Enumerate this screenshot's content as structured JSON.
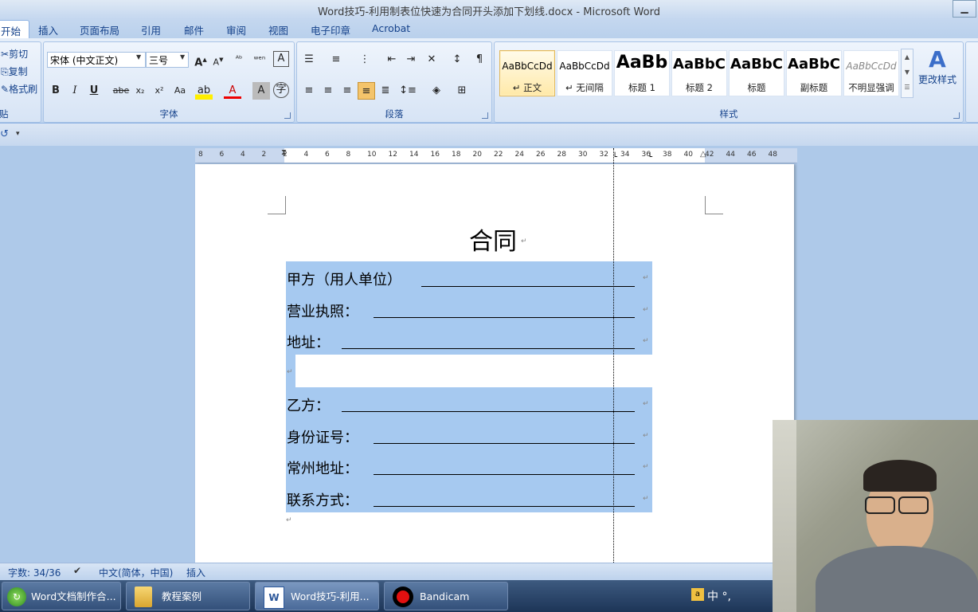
{
  "window": {
    "title": "Word技巧-利用制表位快速为合同开头添加下划线.docx - Microsoft Word"
  },
  "tabs": [
    "开始",
    "插入",
    "页面布局",
    "引用",
    "邮件",
    "审阅",
    "视图",
    "电子印章",
    "Acrobat"
  ],
  "clipboard": {
    "cut": "剪切",
    "copy": "复制",
    "format_painter": "格式刷",
    "label": "贴"
  },
  "font": {
    "name": "宋体 (中文正文)",
    "size": "三号",
    "label": "字体"
  },
  "paragraph": {
    "label": "段落"
  },
  "styles": {
    "label": "样式",
    "items": [
      {
        "preview": "AaBbCcDd",
        "name": "↵ 正文"
      },
      {
        "preview": "AaBbCcDd",
        "name": "↵ 无间隔"
      },
      {
        "preview": "AaBb",
        "name": "标题 1"
      },
      {
        "preview": "AaBbC",
        "name": "标题 2"
      },
      {
        "preview": "AaBbC",
        "name": "标题"
      },
      {
        "preview": "AaBbC",
        "name": "副标题"
      },
      {
        "preview": "AaBbCcDd",
        "name": "不明显强调"
      }
    ],
    "change": "更改样式"
  },
  "ruler": {
    "ticks": [
      "8",
      "6",
      "4",
      "2",
      "2",
      "4",
      "6",
      "8",
      "10",
      "12",
      "14",
      "16",
      "18",
      "20",
      "22",
      "24",
      "26",
      "28",
      "30",
      "32",
      "34",
      "36",
      "38",
      "40",
      "42",
      "44",
      "46",
      "48"
    ]
  },
  "document": {
    "title": "合同",
    "para_mark": "↵",
    "lines": [
      "甲方（用人单位）",
      "营业执照：",
      "地址：",
      "乙方：",
      "身份证号：",
      "常州地址：",
      "联系方式："
    ]
  },
  "statusbar": {
    "words": "字数: 34/36",
    "lang": "中文(简体，中国)",
    "mode": "插入"
  },
  "taskbar": {
    "items": [
      "Word文档制作合...",
      "教程案例",
      "Word技巧-利用...",
      "Bandicam"
    ],
    "ime": "中 °,"
  }
}
